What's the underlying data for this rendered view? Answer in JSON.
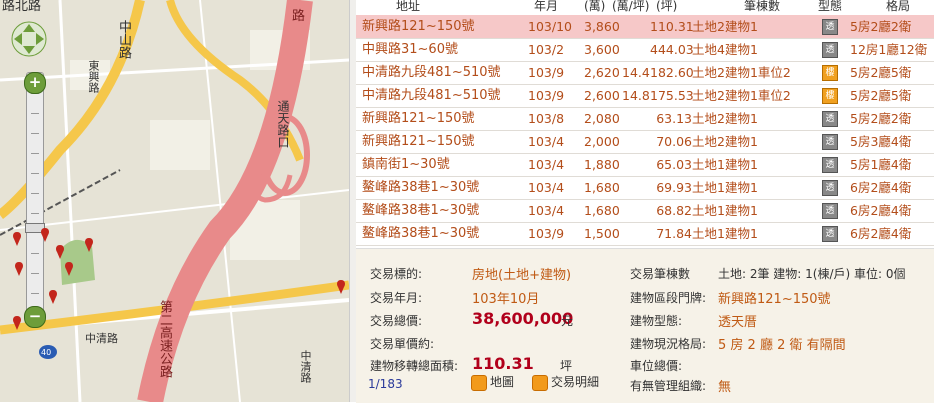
{
  "map": {
    "labels": {
      "top_left": "路北路",
      "zhongshan": "中山路",
      "east_road": "東興路",
      "ramp": "通天路口",
      "highway": "第二高速公路",
      "zhongqing": "中清路",
      "north_label": "中清路",
      "freeway_sign": "路"
    },
    "route_number": "40",
    "zoom_in": "+",
    "zoom_out": "−",
    "colors": {
      "highway": "#e88a8a",
      "road": "#f5c74a",
      "bg": "#e6e3d6",
      "zoom": "#6d9d3a"
    }
  },
  "list": {
    "headers": {
      "address": "地址",
      "year_month": "年月",
      "price": "(萬)",
      "unit_price": "(萬/坪)",
      "area": "(坪)",
      "count": "筆棟數",
      "type": "型態",
      "layout": "格局"
    },
    "rows": [
      {
        "address": "新興路121~150號",
        "year_month": "103/10",
        "price": "3,860",
        "unit_price": "",
        "area": "110.31",
        "count": "土地2建物1",
        "type_icon": "透",
        "layout": "5房2廳2衛",
        "selected": true
      },
      {
        "address": "中興路31~60號",
        "year_month": "103/2",
        "price": "3,600",
        "unit_price": "",
        "area": "444.03",
        "count": "土地4建物1",
        "type_icon": "透",
        "layout": "12房1廳12衛"
      },
      {
        "address": "中清路九段481~510號",
        "year_month": "103/9",
        "price": "2,620",
        "unit_price": "14.4",
        "area": "182.60",
        "count": "土地2建物1車位2",
        "type_icon": "樓",
        "layout": "5房2廳5衛",
        "orange": true
      },
      {
        "address": "中清路九段481~510號",
        "year_month": "103/9",
        "price": "2,600",
        "unit_price": "14.8",
        "area": "175.53",
        "count": "土地2建物1車位2",
        "type_icon": "樓",
        "layout": "5房2廳5衛",
        "orange": true
      },
      {
        "address": "新興路121~150號",
        "year_month": "103/8",
        "price": "2,080",
        "unit_price": "",
        "area": "63.13",
        "count": "土地2建物1",
        "type_icon": "透",
        "layout": "5房2廳2衛"
      },
      {
        "address": "新興路121~150號",
        "year_month": "103/4",
        "price": "2,000",
        "unit_price": "",
        "area": "70.06",
        "count": "土地2建物1",
        "type_icon": "透",
        "layout": "5房3廳4衛"
      },
      {
        "address": "鎮南街1~30號",
        "year_month": "103/4",
        "price": "1,880",
        "unit_price": "",
        "area": "65.03",
        "count": "土地1建物1",
        "type_icon": "透",
        "layout": "5房1廳4衛"
      },
      {
        "address": "鳌峰路38巷1~30號",
        "year_month": "103/4",
        "price": "1,680",
        "unit_price": "",
        "area": "69.93",
        "count": "土地1建物1",
        "type_icon": "透",
        "layout": "6房2廳4衛"
      },
      {
        "address": "鳌峰路38巷1~30號",
        "year_month": "103/4",
        "price": "1,680",
        "unit_price": "",
        "area": "68.82",
        "count": "土地1建物1",
        "type_icon": "透",
        "layout": "6房2廳4衛"
      },
      {
        "address": "鳌峰路38巷1~30號",
        "year_month": "103/9",
        "price": "1,500",
        "unit_price": "",
        "area": "71.84",
        "count": "土地1建物1",
        "type_icon": "透",
        "layout": "6房2廳4衛"
      }
    ]
  },
  "detail": {
    "target_label": "交易標的:",
    "target_value": "房地(土地+建物)",
    "date_label": "交易年月:",
    "date_value": "103年10月",
    "total_label": "交易總價:",
    "total_value": "38,600,000",
    "total_unit": "元",
    "unit_label": "交易單價約:",
    "area_label": "建物移轉總面積:",
    "area_value": "110.31",
    "area_unit": "坪",
    "count_label": "交易筆棟數",
    "count_value": "土地: 2筆 建物: 1(棟/戶) 車位: 0個",
    "address_label": "建物區段門牌:",
    "address_value": "新興路121~150號",
    "type_label": "建物型態:",
    "type_value": "透天厝",
    "layout_label": "建物現況格局:",
    "layout_value": "5 房 2 廳 2 衛 有隔間",
    "parking_label": "車位總價:",
    "mgmt_label": "有無管理組織:",
    "mgmt_value": "無",
    "pager": "1/183",
    "map_button": "地圖",
    "detail_button": "交易明細"
  }
}
